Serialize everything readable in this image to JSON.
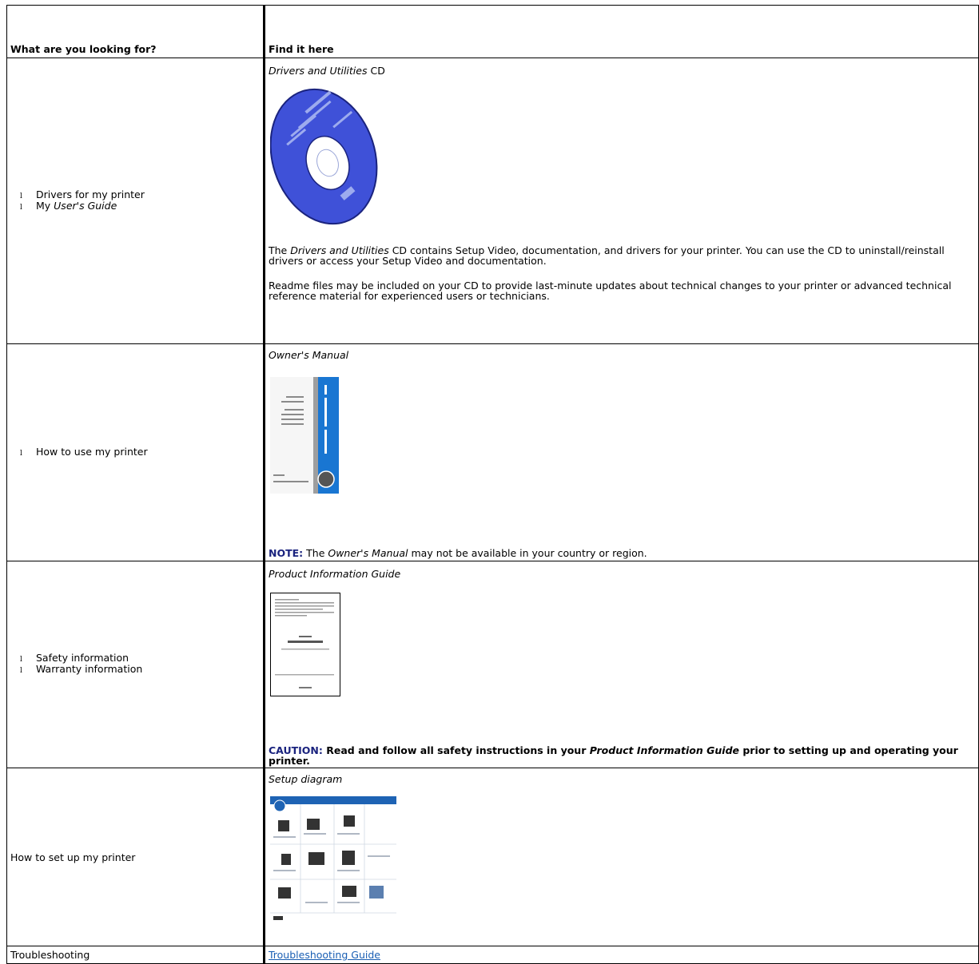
{
  "header": {
    "col1": "What are you looking for?",
    "col2": "Find it here"
  },
  "rows": [
    {
      "left": {
        "bullets": [
          {
            "text": "Drivers for my printer"
          },
          {
            "pre": "My ",
            "italic": "User's Guide"
          }
        ]
      },
      "right": {
        "title_italic": "Drivers and Utilities",
        "title_plain": " CD",
        "image_name": "cd-image",
        "para1_pre": "The ",
        "para1_italic": "Drivers and Utilities",
        "para1_post": " CD contains Setup Video, documentation, and drivers for your printer. You can use the CD to uninstall/reinstall drivers or access your Setup Video and documentation.",
        "para2": "Readme files may be included on your CD to provide last-minute updates about technical changes to your printer or advanced technical reference material for experienced users or technicians."
      }
    },
    {
      "left": {
        "bullets": [
          {
            "text": "How to use my printer"
          }
        ]
      },
      "right": {
        "title_italic": "Owner's Manual",
        "image_name": "owners-manual-image",
        "note_label": "NOTE:",
        "note_pre": " The ",
        "note_italic": "Owner's Manual",
        "note_post": " may not be available in your country or region."
      }
    },
    {
      "left": {
        "bullets": [
          {
            "text": "Safety information"
          },
          {
            "text": "Warranty information"
          }
        ]
      },
      "right": {
        "title_italic": "Product Information Guide",
        "image_name": "product-information-guide-image",
        "caution_label": "CAUTION:",
        "caution_pre": " Read and follow all safety instructions in your ",
        "caution_italic": "Product Information Guide",
        "caution_post": " prior to setting up and operating your printer."
      }
    },
    {
      "left": {
        "text": "How to set up my printer"
      },
      "right": {
        "title_italic": "Setup diagram",
        "image_name": "setup-diagram-image"
      }
    },
    {
      "left": {
        "text": "Troubleshooting"
      },
      "right": {
        "link": "Troubleshooting Guide"
      }
    }
  ],
  "bullet_glyph": "l",
  "colors": {
    "note_label": "#1a237e",
    "link": "#1a5fb4",
    "cd_blue": "#3f51d8",
    "manual_blue": "#1976d2"
  }
}
